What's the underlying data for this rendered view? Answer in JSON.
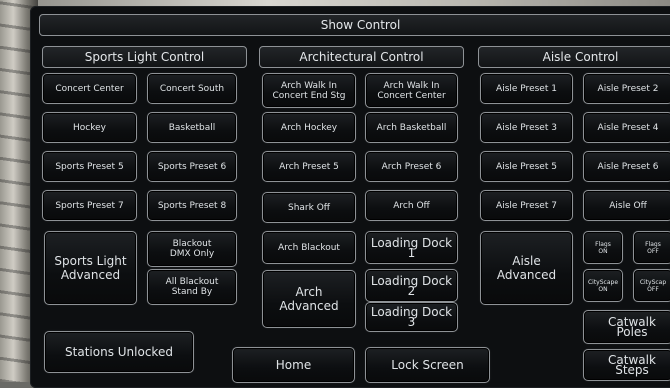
{
  "title": "Show Control",
  "sections": {
    "sports": "Sports Light Control",
    "arch": "Architectural Control",
    "aisle": "Aisle Control"
  },
  "sports": {
    "concert_center": "Concert Center",
    "concert_south": "Concert South",
    "hockey": "Hockey",
    "basketball": "Basketball",
    "preset5": "Sports Preset 5",
    "preset6": "Sports Preset 6",
    "preset7": "Sports Preset 7",
    "preset8": "Sports Preset 8",
    "advanced": "Sports Light\nAdvanced",
    "blackout_dmx": "Blackout\nDMX Only",
    "all_blackout": "All Blackout\nStand By"
  },
  "arch": {
    "walk_end": "Arch Walk In\nConcert End Stg",
    "walk_center": "Arch Walk In\nConcert Center",
    "hockey": "Arch Hockey",
    "basketball": "Arch Basketball",
    "preset5": "Arch Preset 5",
    "preset6": "Arch Preset 6",
    "shark_off": "Shark Off",
    "arch_off": "Arch Off",
    "blackout": "Arch Blackout",
    "advanced": "Arch\nAdvanced",
    "dock1": "Loading Dock 1",
    "dock2": "Loading Dock 2",
    "dock3": "Loading Dock 3"
  },
  "aisle": {
    "preset1": "Aisle Preset 1",
    "preset2": "Aisle Preset 2",
    "preset3": "Aisle Preset 3",
    "preset4": "Aisle Preset 4",
    "preset5": "Aisle Preset 5",
    "preset6": "Aisle Preset 6",
    "preset7": "Aisle Preset 7",
    "off": "Aisle Off",
    "advanced": "Aisle\nAdvanced",
    "flags_on": "Flags\nON",
    "flags_off": "Flags\nOFF",
    "cityscape_on": "CityScape\nON",
    "cityscape_off": "CityScap\nOFF",
    "catwalk_poles": "Catwalk Poles",
    "catwalk_steps": "Catwalk Steps"
  },
  "footer": {
    "stations": "Stations Unlocked",
    "home": "Home",
    "lock": "Lock Screen"
  }
}
